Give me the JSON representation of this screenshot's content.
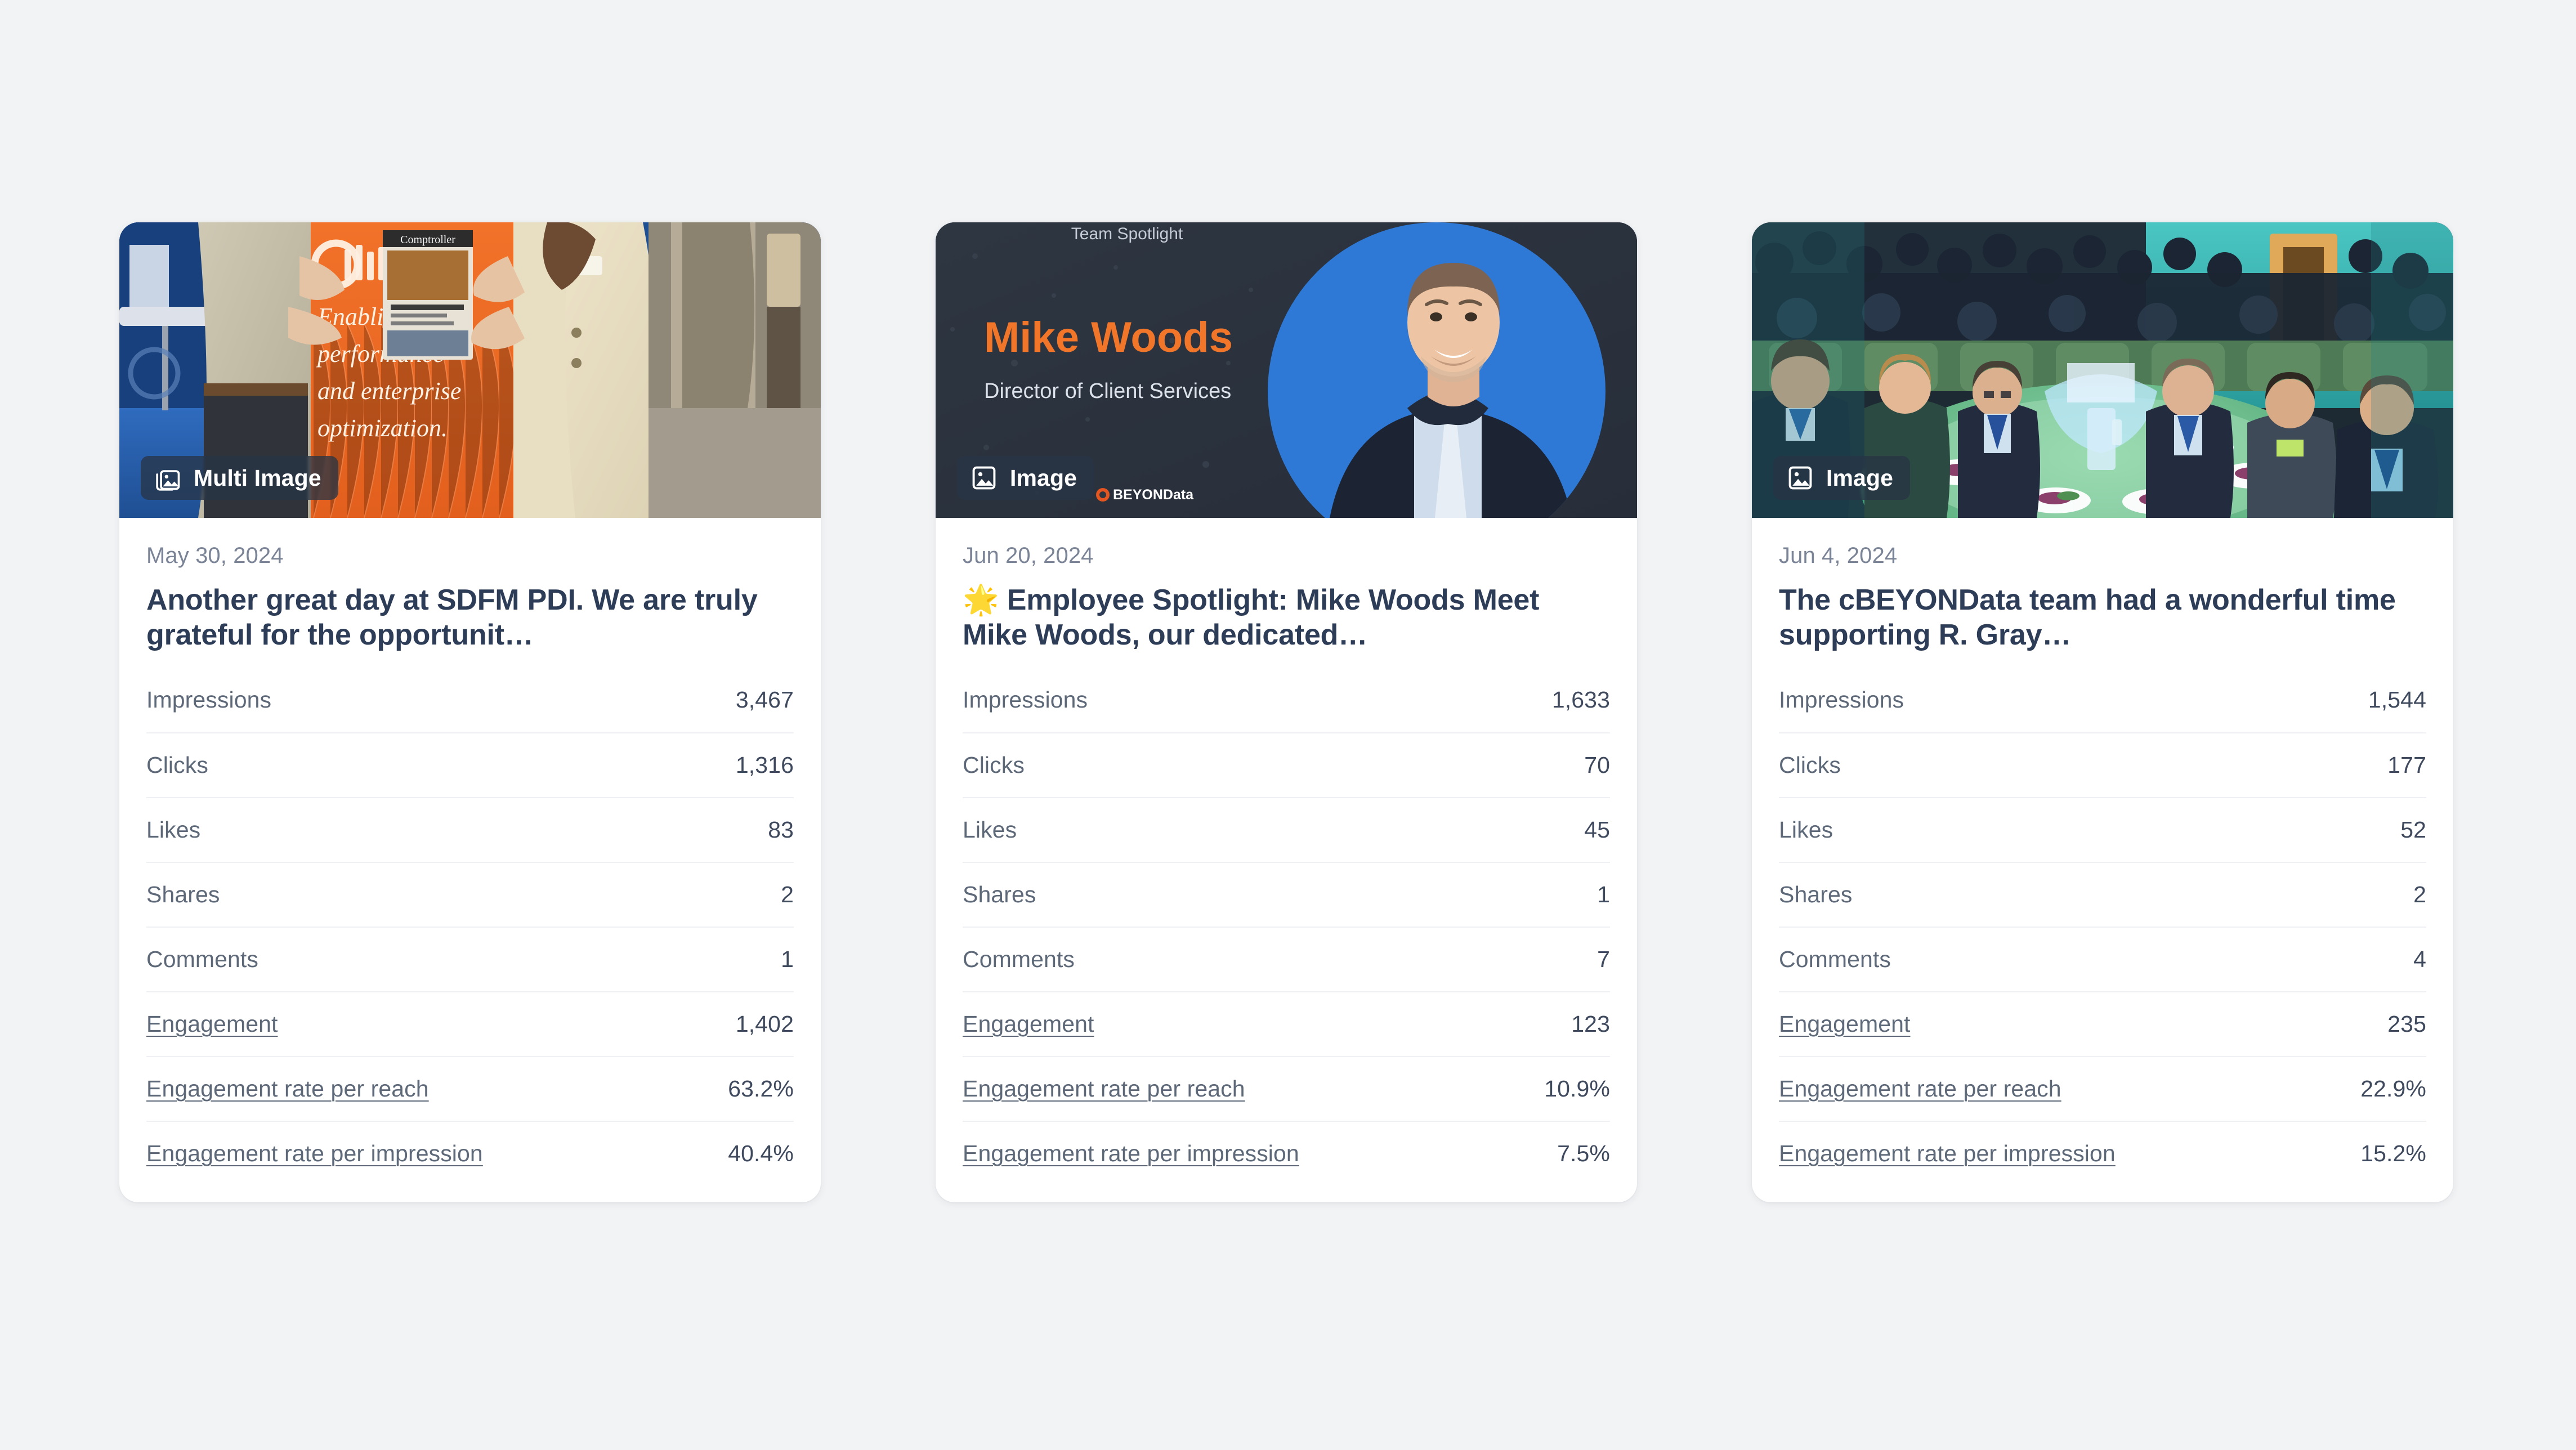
{
  "page": {
    "background_color": "#f2f3f5",
    "title_color": "#2d3c57",
    "label_color": "#5d6878",
    "value_color": "#3f4a5e",
    "date_color": "#7a8496",
    "divider_color": "#eef0f3"
  },
  "metric_labels": {
    "impressions": "Impressions",
    "clicks": "Clicks",
    "likes": "Likes",
    "shares": "Shares",
    "comments": "Comments",
    "engagement": "Engagement",
    "rate_reach": "Engagement rate per reach",
    "rate_impression": "Engagement rate per impression"
  },
  "cards": [
    {
      "badge": {
        "label": "Multi Image",
        "icon": "multi-image-icon"
      },
      "date": "May 30, 2024",
      "title": "Another great day at SDFM PDI. We are truly grateful for the opportunit…",
      "media": {
        "kind": "photo-tradeshow-booth",
        "alt": "Two people at a cBEYONData trade show booth holding a Comptroller magazine in front of an orange banner reading Enabling peak performance and enterprise optimization.",
        "banner_text_lines": [
          "Enabling peak",
          "performance",
          "and enterprise",
          "optimization."
        ],
        "banner_brand": "cBEYONData",
        "magazine_title": "Comptroller"
      },
      "metrics": {
        "impressions": "3,467",
        "clicks": "1,316",
        "likes": "83",
        "shares": "2",
        "comments": "1",
        "engagement": "1,402",
        "rate_reach": "63.2%",
        "rate_impression": "40.4%"
      }
    },
    {
      "badge": {
        "label": "Image",
        "icon": "image-icon"
      },
      "date": "Jun 20, 2024",
      "title": "🌟 Employee Spotlight: Mike Woods Meet Mike Woods, our dedicated…",
      "media": {
        "kind": "graphic-team-spotlight",
        "alt": "Dark navy Team Spotlight graphic with a headshot of Mike Woods on a blue circle.",
        "eyebrow": "Team Spotlight",
        "name": "Mike Woods",
        "role": "Director of Client Services",
        "logo": "cBEYONData",
        "name_color": "#f2762a",
        "accent_circle_color": "#2f79d6",
        "background_color": "#2c3440"
      },
      "metrics": {
        "impressions": "1,633",
        "clicks": "70",
        "likes": "45",
        "shares": "1",
        "comments": "7",
        "engagement": "123",
        "rate_reach": "10.9%",
        "rate_impression": "7.5%"
      }
    },
    {
      "badge": {
        "label": "Image",
        "icon": "image-icon"
      },
      "date": "Jun 4, 2024",
      "title": "The cBEYONData team had a wonderful time supporting R. Gray…",
      "media": {
        "kind": "photo-gala-banquet",
        "alt": "Crowded banquet hall with guests seated around a round table with a green tablecloth and teal uplighting."
      },
      "metrics": {
        "impressions": "1,544",
        "clicks": "177",
        "likes": "52",
        "shares": "2",
        "comments": "4",
        "engagement": "235",
        "rate_reach": "22.9%",
        "rate_impression": "15.2%"
      }
    }
  ]
}
